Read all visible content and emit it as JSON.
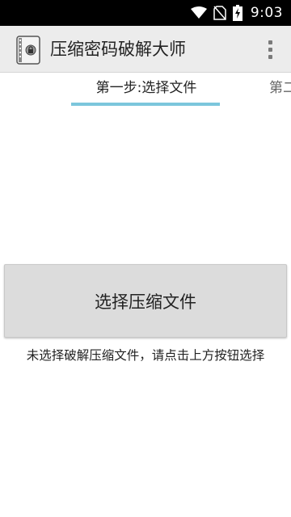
{
  "status_bar": {
    "time": "9:03",
    "icons": [
      "wifi-icon",
      "no-sim-icon",
      "battery-charging-icon"
    ]
  },
  "app_bar": {
    "title": "压缩密码破解大师",
    "logo_icon": "archive-lock-icon",
    "menu_icon": "overflow-menu-icon"
  },
  "tabs": [
    {
      "label": "第一步:选择文件",
      "selected": true
    },
    {
      "label": "第二",
      "selected": false
    }
  ],
  "colors": {
    "tab_indicator": "#7cc6dc",
    "app_bar_bg": "#ececec",
    "button_bg": "#dcdcdc"
  },
  "main": {
    "select_button_label": "选择压缩文件",
    "status_message": "未选择破解压缩文件，请点击上方按钮选择"
  }
}
